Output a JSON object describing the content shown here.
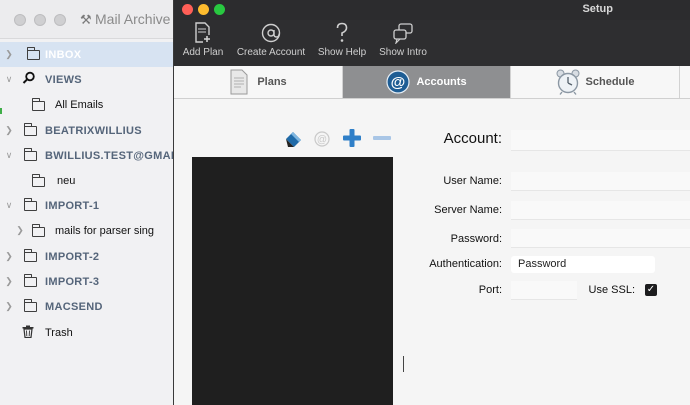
{
  "bg_window": {
    "title": "Mail Archive"
  },
  "sidebar": {
    "items": [
      {
        "label": "INBOX",
        "level": "top",
        "selected": true,
        "icon": "folder-icon",
        "chevron": true
      },
      {
        "label": "VIEWS",
        "level": "top",
        "selected": false,
        "icon": "search-icon",
        "chevron": "down"
      },
      {
        "label": "All Emails",
        "level": "sub",
        "selected": false,
        "icon": "folder-icon",
        "chevron": false
      },
      {
        "label": "BEATRIXWILLIUS",
        "level": "top",
        "selected": false,
        "icon": null,
        "chevron": true
      },
      {
        "label": "BWILLIUS.TEST@GMAI",
        "level": "top",
        "selected": false,
        "icon": null,
        "chevron": "down"
      },
      {
        "label": "neu",
        "level": "sub",
        "selected": false,
        "icon": "folder-icon",
        "chevron": false
      },
      {
        "label": "IMPORT-1",
        "level": "top",
        "selected": false,
        "icon": null,
        "chevron": "down"
      },
      {
        "label": "mails for parser sing",
        "level": "sub",
        "selected": false,
        "icon": "folder-icon",
        "chevron": true
      },
      {
        "label": "IMPORT-2",
        "level": "top",
        "selected": false,
        "icon": null,
        "chevron": true
      },
      {
        "label": "IMPORT-3",
        "level": "top",
        "selected": false,
        "icon": null,
        "chevron": true
      },
      {
        "label": "MACSEND",
        "level": "top",
        "selected": false,
        "icon": null,
        "chevron": true
      },
      {
        "label": "Trash",
        "level": "sub",
        "selected": false,
        "icon": "trash-icon",
        "chevron": false
      }
    ]
  },
  "setup": {
    "title": "Setup",
    "toolbar": [
      {
        "label": "Add Plan",
        "icon": "add-plan-icon"
      },
      {
        "label": "Create Account",
        "icon": "at-sign-icon"
      },
      {
        "label": "Show Help",
        "icon": "help-icon"
      },
      {
        "label": "Show Intro",
        "icon": "speech-bubbles-icon"
      }
    ],
    "tabs": [
      {
        "label": "Plans",
        "icon": "document-icon",
        "active": false
      },
      {
        "label": "Accounts",
        "icon": "at-sign-icon",
        "active": true
      },
      {
        "label": "Schedule",
        "icon": "alarm-clock-icon",
        "active": false
      }
    ],
    "form": {
      "account_label": "Account:",
      "user_name_label": "User Name:",
      "server_name_label": "Server Name:",
      "password_label": "Password:",
      "authentication_label": "Authentication:",
      "authentication_value": "Password",
      "port_label": "Port:",
      "use_ssl_label": "Use SSL:",
      "use_ssl_checked": true,
      "checkmark": "✓"
    }
  },
  "colors": {
    "selected_row": "#d7e3f2",
    "toolbar_bg": "#2e2e30",
    "active_tab": "#8e8f91",
    "plus_blue": "#2f7fc8",
    "account_list_bg": "#1f1f1f"
  }
}
